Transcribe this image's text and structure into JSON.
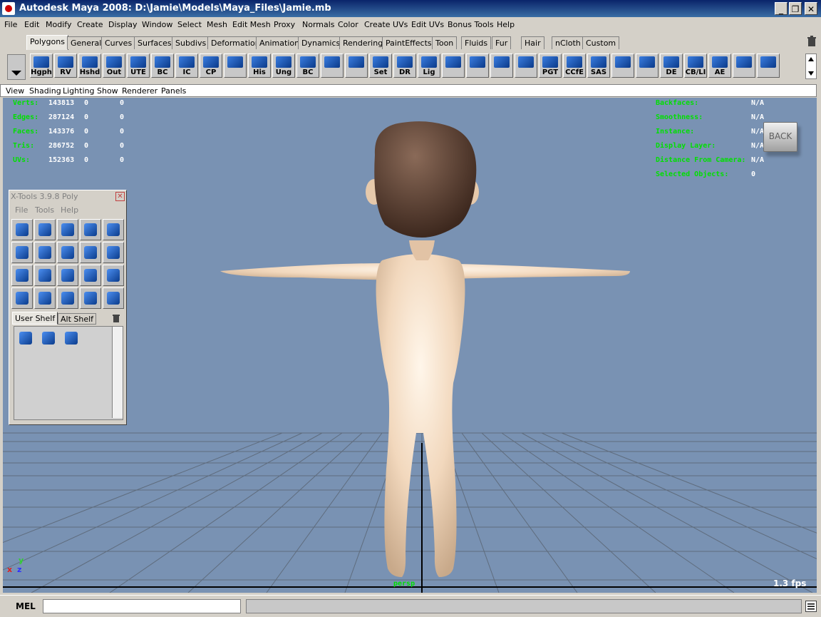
{
  "window": {
    "title": "Autodesk Maya 2008: D:\\Jamie\\Models\\Maya_Files\\Jamie.mb"
  },
  "menu": [
    "File",
    "Edit",
    "Modify",
    "Create",
    "Display",
    "Window",
    "Select",
    "Mesh",
    "Edit Mesh",
    "Proxy",
    "Normals",
    "Color",
    "Create UVs",
    "Edit UVs",
    "Bonus Tools",
    "Help"
  ],
  "shelf_tabs": [
    "Polygons",
    "General",
    "Curves",
    "Surfaces",
    "Subdivs",
    "Deformation",
    "Animation",
    "Dynamics",
    "Rendering",
    "PaintEffects",
    "Toon",
    "Fluids",
    "Fur",
    "Hair",
    "nCloth",
    "Custom"
  ],
  "shelf_buttons": [
    "Hgph",
    "RV",
    "Hshd",
    "Out",
    "UTE",
    "BC",
    "IC",
    "CP",
    "",
    "His",
    "Ung",
    "BC",
    "",
    "",
    "Set",
    "DR",
    "Lig",
    "",
    "",
    "",
    "",
    "PGT",
    "CCfE",
    "SAS",
    "",
    "",
    "DE",
    "CB/LI",
    "AE",
    "",
    ""
  ],
  "panel_menu": [
    "View",
    "Shading",
    "Lighting",
    "Show",
    "Renderer",
    "Panels"
  ],
  "hud_left": [
    {
      "label": "Verts:",
      "a": "143813",
      "b": "0",
      "c": "0"
    },
    {
      "label": "Edges:",
      "a": "287124",
      "b": "0",
      "c": "0"
    },
    {
      "label": "Faces:",
      "a": "143376",
      "b": "0",
      "c": "0"
    },
    {
      "label": "Tris:",
      "a": "286752",
      "b": "0",
      "c": "0"
    },
    {
      "label": "UVs:",
      "a": "152363",
      "b": "0",
      "c": "0"
    }
  ],
  "hud_right": [
    {
      "label": "Backfaces:",
      "value": "N/A"
    },
    {
      "label": "Smoothness:",
      "value": "N/A"
    },
    {
      "label": "Instance:",
      "value": "N/A"
    },
    {
      "label": "Display Layer:",
      "value": "N/A"
    },
    {
      "label": "Distance From Camera:",
      "value": "N/A"
    },
    {
      "label": "Selected Objects:",
      "value": "0"
    }
  ],
  "viewcube_label": "BACK",
  "camera_label": "persp",
  "fps": "1.3 fps",
  "axis": {
    "x": "x",
    "y": "y",
    "z": "z"
  },
  "xtools": {
    "title": "X-Tools 3.9.8 Poly",
    "menu": [
      "File",
      "Tools",
      "Help"
    ],
    "tabs": [
      "User Shelf",
      "Alt Shelf"
    ]
  },
  "command_line": {
    "label": "MEL",
    "value": ""
  }
}
